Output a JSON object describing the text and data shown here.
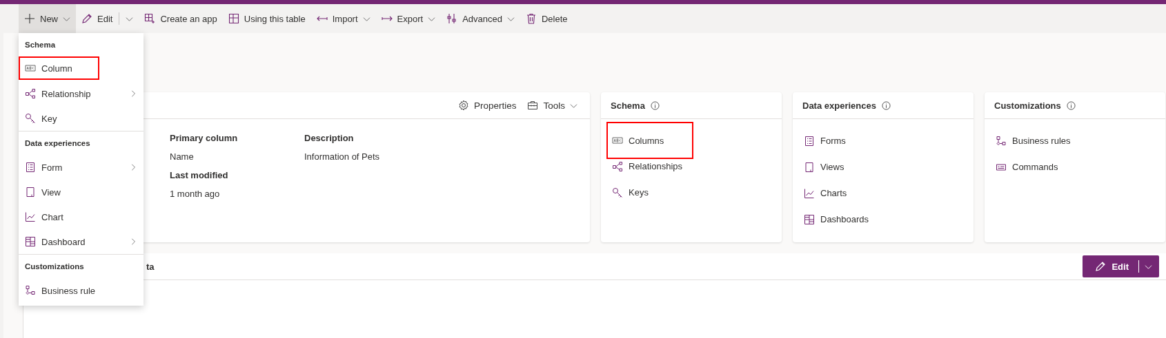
{
  "command_bar": [
    {
      "label": "New",
      "kind": "dropdown",
      "selected": true
    },
    {
      "label": "Edit",
      "kind": "split",
      "selected": false
    },
    {
      "label": "Create an app",
      "kind": "plain",
      "selected": false
    },
    {
      "label": "Using this table",
      "kind": "plain",
      "selected": false
    },
    {
      "label": "Import",
      "kind": "dropdown",
      "selected": false
    },
    {
      "label": "Export",
      "kind": "dropdown",
      "selected": false
    },
    {
      "label": "Advanced",
      "kind": "dropdown",
      "selected": false
    },
    {
      "label": "Delete",
      "kind": "plain",
      "selected": false
    }
  ],
  "new_menu": {
    "sections": [
      {
        "header": "Schema",
        "items": [
          {
            "label": "Column",
            "submenu": false,
            "highlighted": true
          },
          {
            "label": "Relationship",
            "submenu": true,
            "highlighted": false
          },
          {
            "label": "Key",
            "submenu": false,
            "highlighted": false
          }
        ]
      },
      {
        "header": "Data experiences",
        "items": [
          {
            "label": "Form",
            "submenu": true,
            "highlighted": false
          },
          {
            "label": "View",
            "submenu": false,
            "highlighted": false
          },
          {
            "label": "Chart",
            "submenu": false,
            "highlighted": false
          },
          {
            "label": "Dashboard",
            "submenu": true,
            "highlighted": false
          }
        ]
      },
      {
        "header": "Customizations",
        "items": [
          {
            "label": "Business rule",
            "submenu": false,
            "highlighted": false
          }
        ]
      }
    ]
  },
  "table_card": {
    "actions": [
      {
        "label": "Properties",
        "kind": "plain"
      },
      {
        "label": "Tools",
        "kind": "dropdown"
      }
    ],
    "columns": [
      [
        {
          "label": "Primary column",
          "value": "Name"
        },
        {
          "label": "Last modified",
          "value": "1 month ago"
        }
      ],
      [
        {
          "label": "Description",
          "value": "Information of Pets"
        }
      ]
    ]
  },
  "panels": [
    {
      "title": "Schema",
      "items": [
        {
          "label": "Columns",
          "highlighted": true
        },
        {
          "label": "Relationships",
          "highlighted": false
        },
        {
          "label": "Keys",
          "highlighted": false
        }
      ]
    },
    {
      "title": "Data experiences",
      "items": [
        {
          "label": "Forms",
          "highlighted": false
        },
        {
          "label": "Views",
          "highlighted": false
        },
        {
          "label": "Charts",
          "highlighted": false
        },
        {
          "label": "Dashboards",
          "highlighted": false
        }
      ]
    },
    {
      "title": "Customizations",
      "items": [
        {
          "label": "Business rules",
          "highlighted": false
        },
        {
          "label": "Commands",
          "highlighted": false
        }
      ]
    }
  ],
  "data_panel": {
    "title": "ta",
    "edit_button": {
      "label": "Edit",
      "kind": "split"
    }
  }
}
